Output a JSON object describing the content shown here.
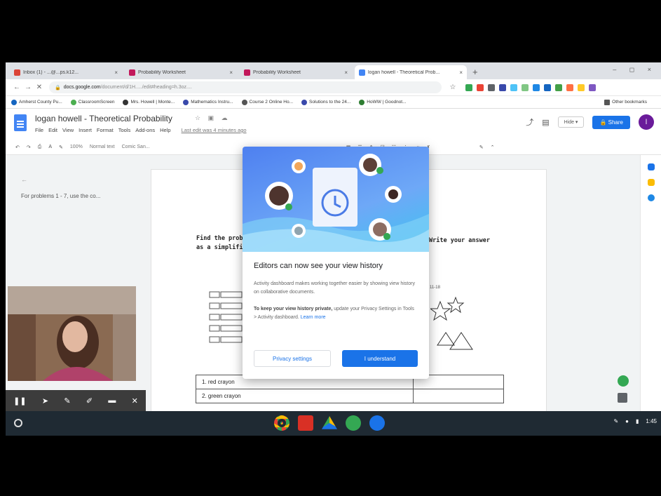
{
  "browser": {
    "tabs": [
      {
        "label": "Inbox (1) - ...@...ps.k12...",
        "favicon_color": "#db4437",
        "active": false
      },
      {
        "label": "Probability Worksheet",
        "favicon_color": "#c2185b",
        "active": false
      },
      {
        "label": "Probability Worksheet",
        "favicon_color": "#c2185b",
        "active": false
      },
      {
        "label": "logan howell - Theoretical Prob...",
        "favicon_color": "#4285f4",
        "active": true
      }
    ],
    "new_tab": "+",
    "window_controls": "– ◻ ×",
    "url_host": "docs.google.com",
    "url_path": "/document/d/1H...../edit#heading=h.3oz....",
    "bookmarks": [
      {
        "label": "Amherst County Pu...",
        "color": "#1565c0"
      },
      {
        "label": "ClassroomScreen",
        "color": "#4caf50"
      },
      {
        "label": "Mrs. Howell | Monte...",
        "color": "#333333"
      },
      {
        "label": "Mathematics Instru...",
        "color": "#3949ab"
      },
      {
        "label": "Course 2 Online Ho...",
        "color": "#555555"
      },
      {
        "label": "Solutions to the 24...",
        "color": "#3949ab"
      },
      {
        "label": "HoWW | Goodnot...",
        "color": "#2e7d32"
      }
    ],
    "other_bookmarks": "Other bookmarks"
  },
  "docs": {
    "title": "logan howell - Theoretical Probability",
    "menu": [
      "File",
      "Edit",
      "View",
      "Insert",
      "Format",
      "Tools",
      "Add-ons",
      "Help"
    ],
    "last_edit": "Last edit was 4 minutes ago",
    "hide_label": "Hide ▾",
    "share_label": "Share",
    "avatar_letter": "l",
    "toolbar": [
      "100%",
      "Normal text",
      "Comic San..."
    ],
    "outline_item": "For problems 1 - 7, use the co...",
    "problem_left": "Find the prob\nas a simplifie",
    "problem_right": "Write your answer",
    "bag_note": "g 11-18",
    "table_rows": [
      "1.  red crayon",
      "2.  green crayon"
    ]
  },
  "dialog": {
    "title": "Editors can now see your view history",
    "body": "Activity dashboard makes working together easier by showing view history on collaborative documents.",
    "privacy_bold": "To keep your view history private,",
    "privacy_rest": "update your Privacy Settings in Tools > Activity dashboard.",
    "learn_more": "Learn more",
    "secondary_button": "Privacy settings",
    "primary_button": "I understand"
  },
  "recorder": {
    "controls": [
      "pause",
      "pointer",
      "pen",
      "highlighter",
      "camera",
      "close"
    ]
  },
  "shelf": {
    "apps": [
      {
        "name": "chrome",
        "color": "#ea4335"
      },
      {
        "name": "gmail",
        "color": "#d93025"
      },
      {
        "name": "drive",
        "color": "#fbbc04"
      },
      {
        "name": "play",
        "color": "#34a853"
      },
      {
        "name": "meet",
        "color": "#1a73e8"
      }
    ],
    "clock": "1:45"
  }
}
